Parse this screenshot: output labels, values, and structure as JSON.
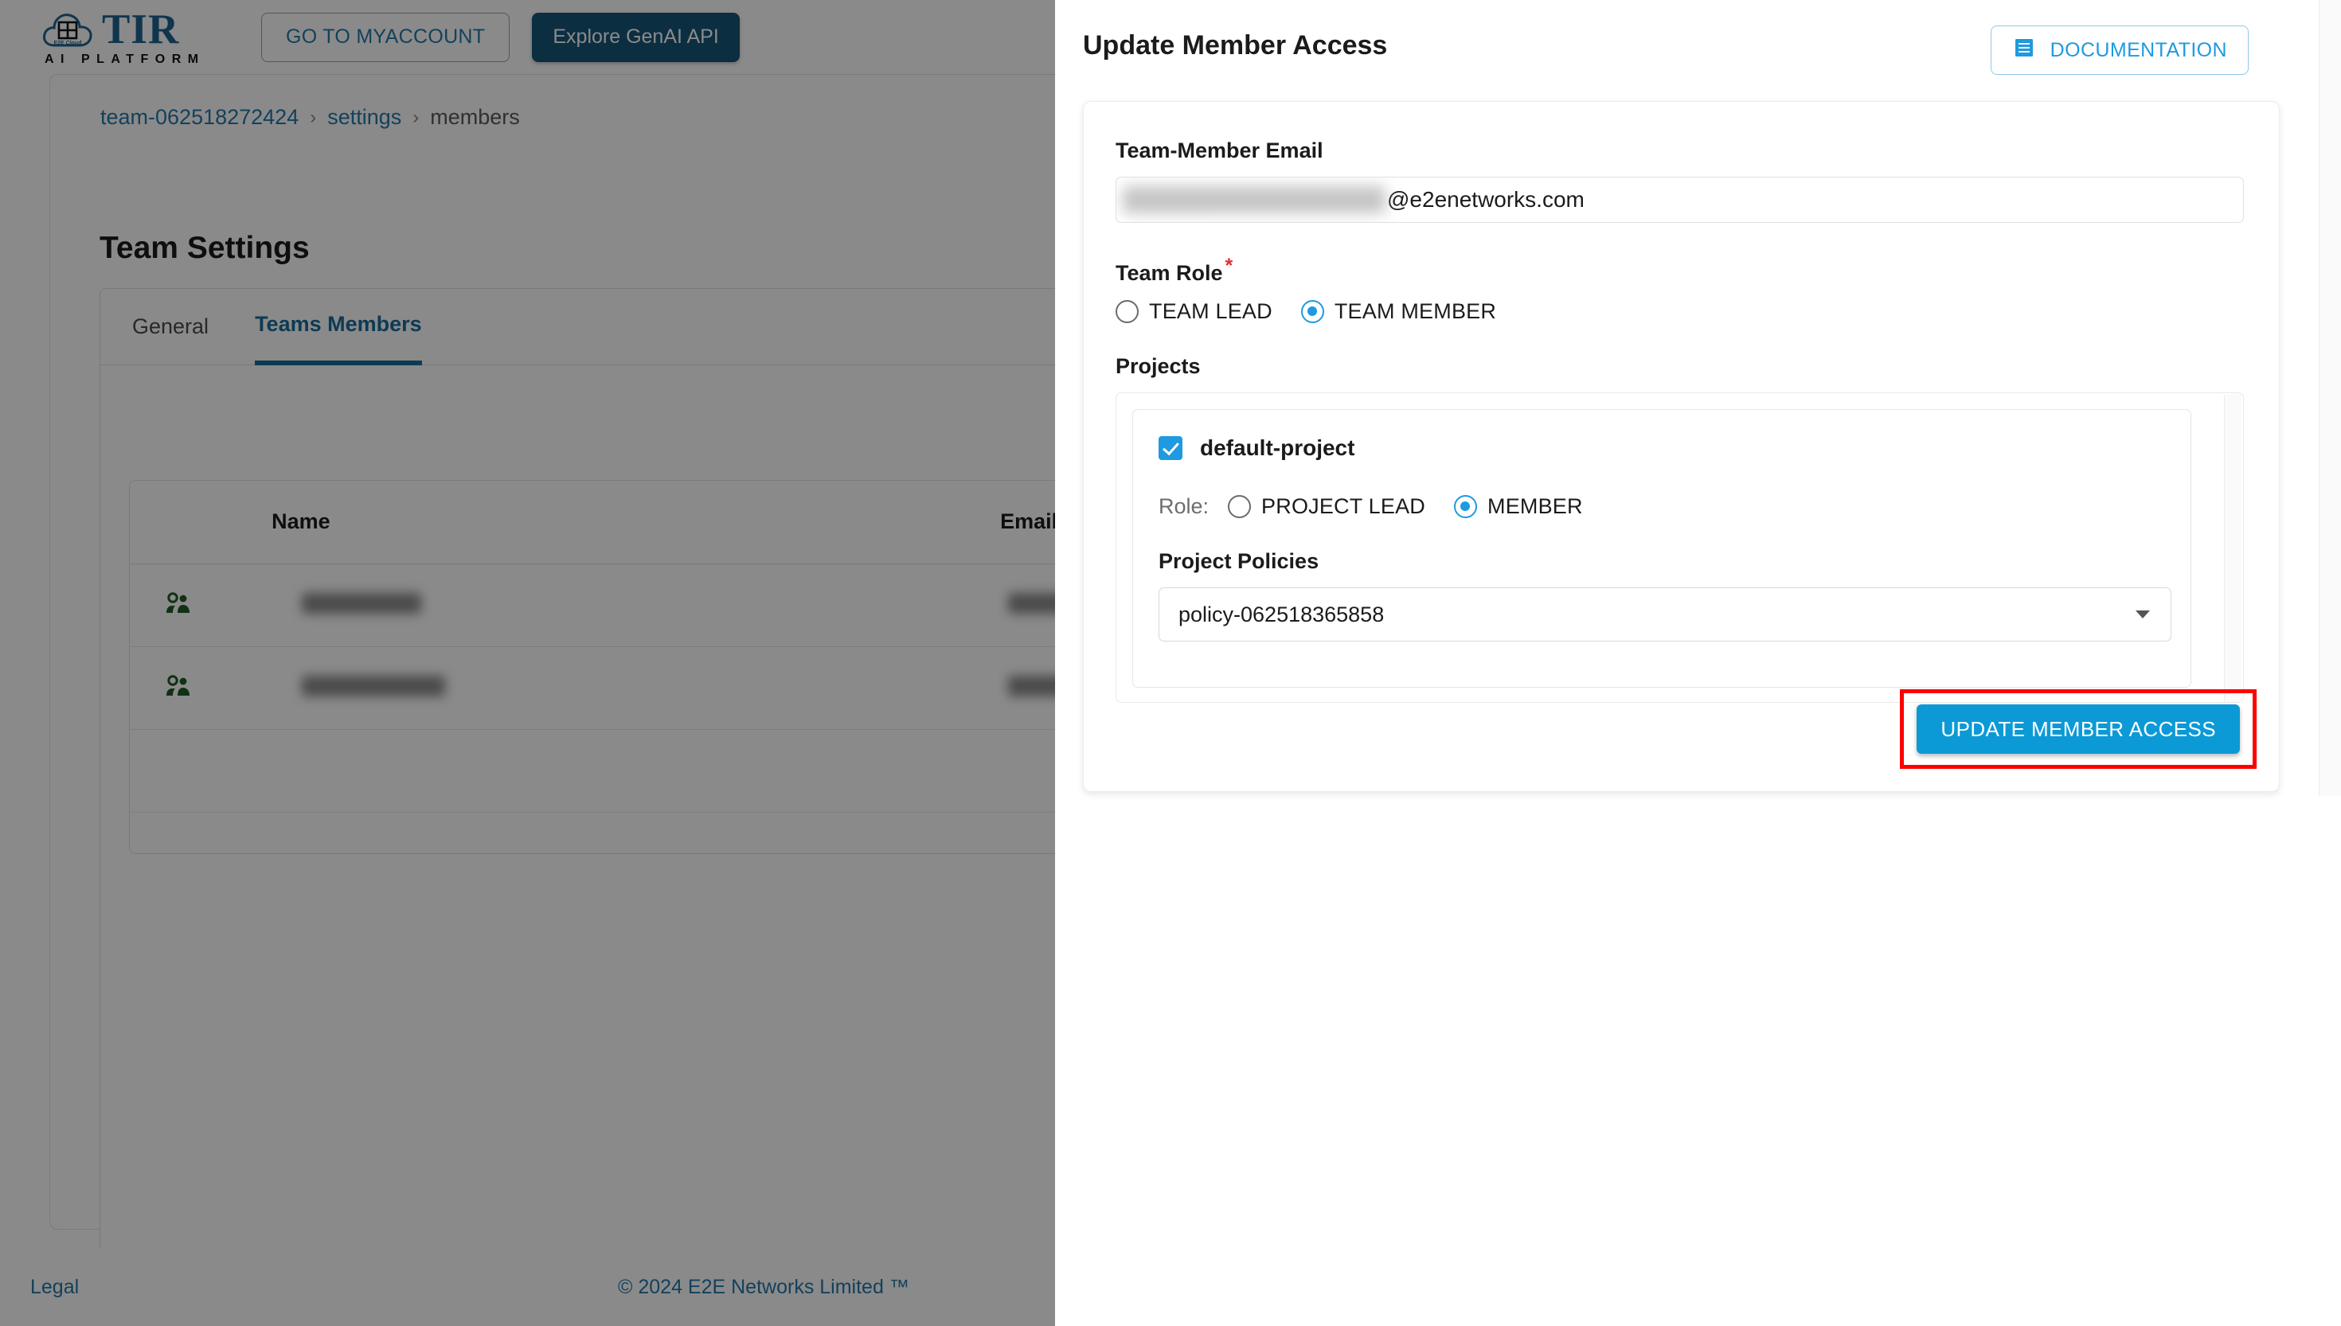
{
  "brand": {
    "logo_text": "TIR",
    "logo_subtitle": "AI PLATFORM",
    "cloud_badge": "E2E Cloud"
  },
  "topnav": {
    "myaccount_label": "GO TO MYACCOUNT",
    "genai_label": "Explore GenAI API"
  },
  "breadcrumb": {
    "team": "team-062518272424",
    "sep": "›",
    "settings": "settings",
    "current": "members"
  },
  "page": {
    "title": "Team Settings"
  },
  "tabs": [
    {
      "label": "General",
      "active": false
    },
    {
      "label": "Teams Members",
      "active": true
    }
  ],
  "members_table": {
    "columns": [
      "",
      "Name",
      "Email"
    ],
    "rows": [
      {
        "icon": "people-icon",
        "name": "",
        "email": ""
      },
      {
        "icon": "people-icon",
        "name": "",
        "email": ""
      }
    ]
  },
  "footer": {
    "legal": "Legal",
    "copyright": "© 2024 E2E Networks Limited ™"
  },
  "drawer": {
    "title": "Update Member Access",
    "documentation_label": "DOCUMENTATION",
    "documentation_icon": "document-lines-icon",
    "email": {
      "label": "Team-Member Email",
      "value_masked": "",
      "domain": "@e2enetworks.com"
    },
    "team_role": {
      "label": "Team Role",
      "required_marker": "*",
      "options": [
        {
          "label": "TEAM LEAD",
          "selected": false
        },
        {
          "label": "TEAM MEMBER",
          "selected": true
        }
      ]
    },
    "projects": {
      "label": "Projects",
      "items": [
        {
          "name": "default-project",
          "checked": true,
          "role_label": "Role:",
          "role_options": [
            {
              "label": "PROJECT LEAD",
              "selected": false
            },
            {
              "label": "MEMBER",
              "selected": true
            }
          ],
          "policies_label": "Project Policies",
          "policy_selected": "policy-062518365858"
        }
      ]
    },
    "submit_label": "UPDATE MEMBER ACCESS"
  },
  "colors": {
    "brand_blue": "#1e6591",
    "accent_blue": "#1e9ae0",
    "primary_button": "#0b9ad6",
    "highlight_red": "#ff0000",
    "link_blue": "#2378a8",
    "people_icon_green": "#1f5c24"
  }
}
